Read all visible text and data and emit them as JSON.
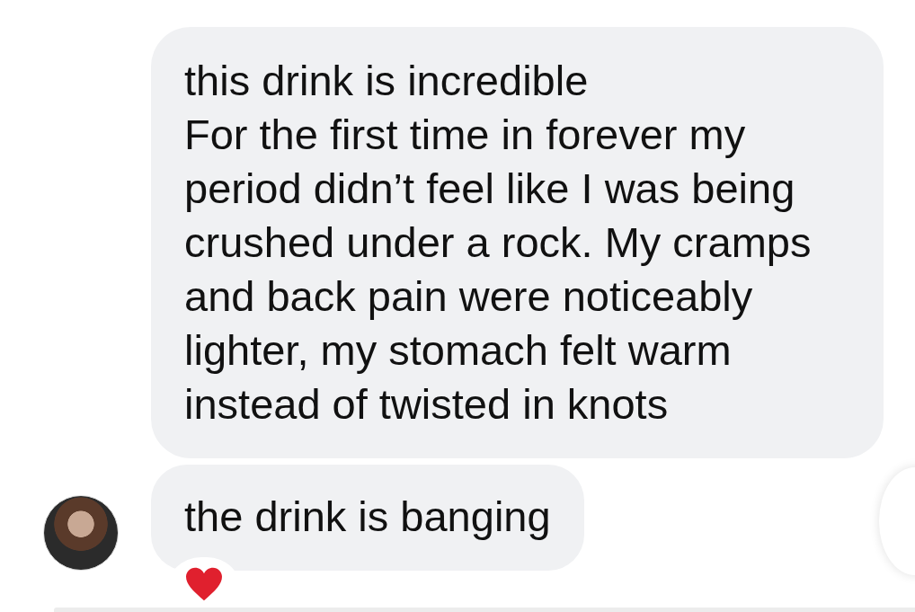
{
  "messages": [
    {
      "kind": "text",
      "lines": [
        "this drink is incredible",
        "For the first time in forever my period didn’t feel like I was being crushed under a rock. My cramps and back pain were noticeably lighter, my stomach felt warm instead of twisted in knots"
      ],
      "avatar": false,
      "reaction": false
    },
    {
      "kind": "text",
      "lines": [
        "the drink is banging"
      ],
      "avatar": true,
      "reaction": true
    }
  ]
}
